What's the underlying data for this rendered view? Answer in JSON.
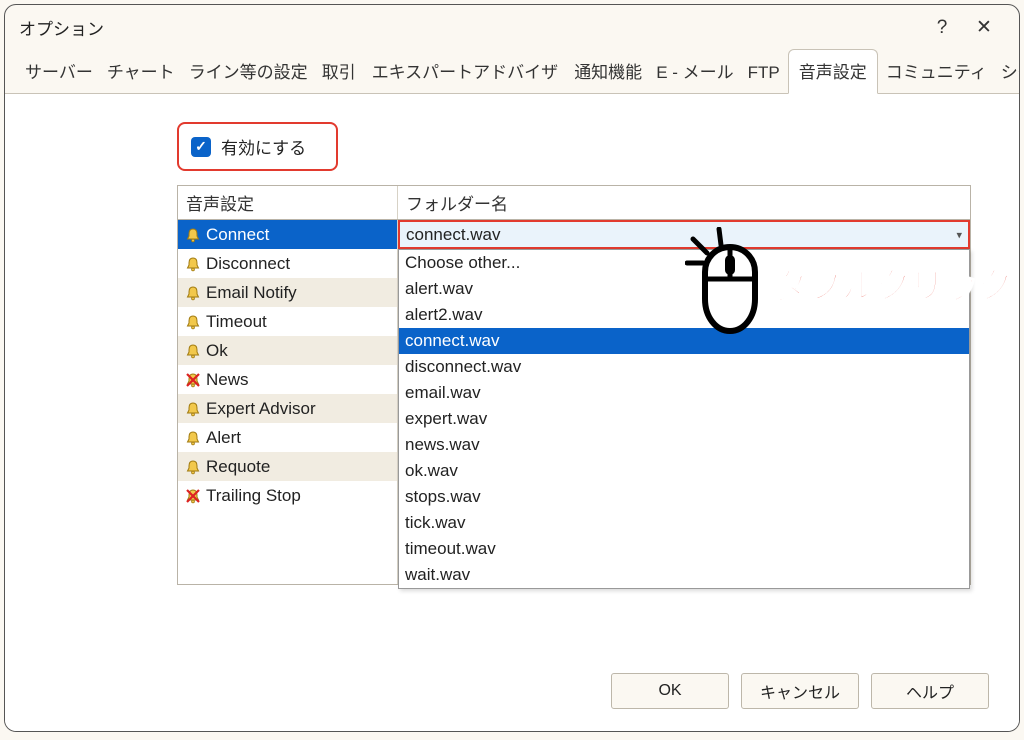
{
  "title": "オプション",
  "titlebar": {
    "help": "?",
    "close": "✕"
  },
  "tabs": {
    "items": [
      {
        "label": "サーバー"
      },
      {
        "label": "チャート"
      },
      {
        "label": "ライン等の設定"
      },
      {
        "label": "取引"
      },
      {
        "label": "エキスパートアドバイザ"
      },
      {
        "label": "通知機能"
      },
      {
        "label": "E - メール"
      },
      {
        "label": "FTP"
      },
      {
        "label": "音声設定",
        "active": true
      },
      {
        "label": "コミュニティ"
      },
      {
        "label": "シグナル"
      }
    ]
  },
  "enable": {
    "label": "有効にする",
    "checked": true
  },
  "columns": {
    "a": "音声設定",
    "b": "フォルダー名"
  },
  "events": [
    {
      "label": "Connect",
      "selected": true,
      "muted": false,
      "alt": false
    },
    {
      "label": "Disconnect",
      "muted": false,
      "alt": false
    },
    {
      "label": "Email Notify",
      "muted": false,
      "alt": true
    },
    {
      "label": "Timeout",
      "muted": false,
      "alt": false
    },
    {
      "label": "Ok",
      "muted": false,
      "alt": true
    },
    {
      "label": "News",
      "muted": true,
      "alt": false
    },
    {
      "label": "Expert Advisor",
      "muted": false,
      "alt": true
    },
    {
      "label": "Alert",
      "muted": false,
      "alt": false
    },
    {
      "label": "Requote",
      "muted": false,
      "alt": true
    },
    {
      "label": "Trailing Stop",
      "muted": true,
      "alt": false
    }
  ],
  "selected_value": "connect.wav",
  "dropdown": {
    "items": [
      {
        "label": "Choose other..."
      },
      {
        "label": "alert.wav"
      },
      {
        "label": "alert2.wav"
      },
      {
        "label": "connect.wav",
        "highlight": true
      },
      {
        "label": "disconnect.wav"
      },
      {
        "label": "email.wav"
      },
      {
        "label": "expert.wav"
      },
      {
        "label": "news.wav"
      },
      {
        "label": "ok.wav"
      },
      {
        "label": "stops.wav"
      },
      {
        "label": "tick.wav"
      },
      {
        "label": "timeout.wav"
      },
      {
        "label": "wait.wav"
      }
    ]
  },
  "annotation": "ダブルクリック",
  "buttons": {
    "ok": "OK",
    "cancel": "キャンセル",
    "help": "ヘルプ"
  }
}
